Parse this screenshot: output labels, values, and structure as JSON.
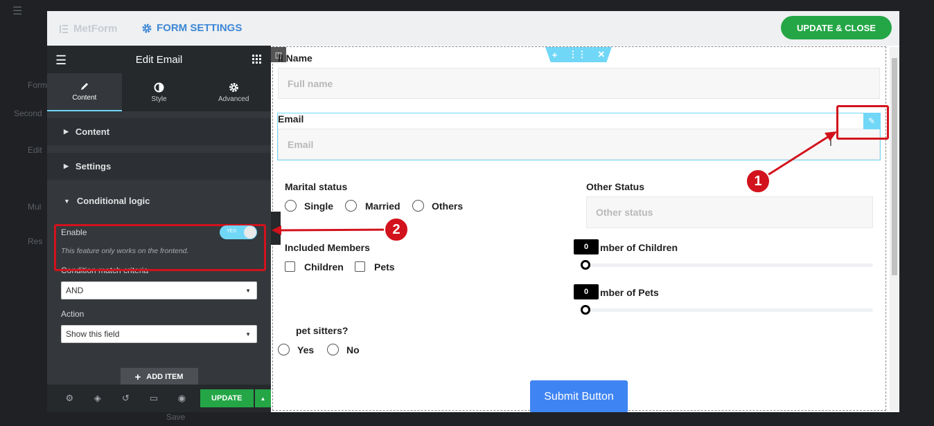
{
  "bg": {
    "items": [
      "Form",
      "Second",
      "Edit",
      "Mul",
      "Res",
      "Save"
    ]
  },
  "header": {
    "brand": "MetForm",
    "tab_title": "FORM SETTINGS",
    "update_close": "UPDATE & CLOSE"
  },
  "panel": {
    "title": "Edit Email",
    "tabs": [
      {
        "label": "Content",
        "icon": "pencil-icon"
      },
      {
        "label": "Style",
        "icon": "contrast-icon"
      },
      {
        "label": "Advanced",
        "icon": "gear-icon"
      }
    ],
    "sections": {
      "content": "Content",
      "settings": "Settings",
      "conditional": "Conditional logic"
    },
    "enable_label": "Enable",
    "toggle_text": "YES",
    "note": "This feature only works on the frontend.",
    "criteria_label": "Condition match criteria",
    "criteria_value": "AND",
    "action_label": "Action",
    "action_value": "Show this field",
    "add_item": "ADD ITEM",
    "update": "UPDATE"
  },
  "form": {
    "full_name_label": "ll Name",
    "full_name_placeholder": "Full name",
    "email_label": "Email",
    "email_placeholder": "Email",
    "marital_label": "Marital status",
    "marital_options": [
      "Single",
      "Married",
      "Others"
    ],
    "other_status_label": "Other Status",
    "other_status_placeholder": "Other status",
    "members_label": "Included Members",
    "members_options": [
      "Children",
      "Pets"
    ],
    "children_label": "mber of Children",
    "children_value": "0",
    "pets_label": "mber of Pets",
    "pets_value": "0",
    "sitters_label": "pet sitters?",
    "sitters_options": [
      "Yes",
      "No"
    ],
    "submit": "Submit Button"
  },
  "annotations": {
    "one": "1",
    "two": "2"
  },
  "colors": {
    "accent": "#3d87d6",
    "green": "#24a646",
    "red": "#d2121c",
    "submit": "#3f84f3",
    "cyan": "#71d7f7"
  }
}
